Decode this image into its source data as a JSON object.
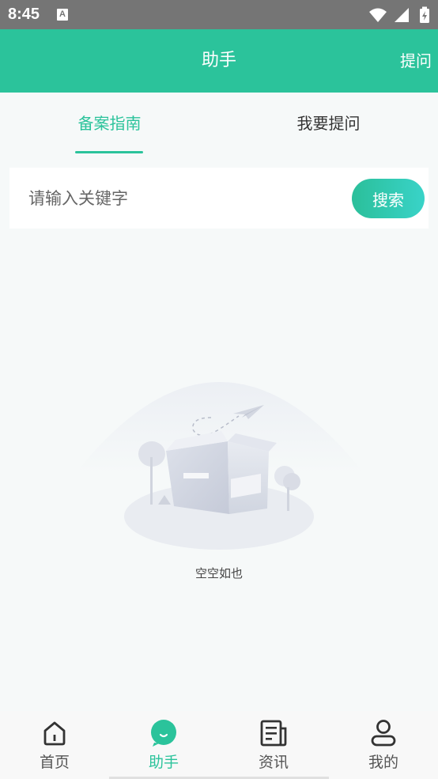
{
  "status_bar": {
    "time": "8:45",
    "notification_icon": "A",
    "icons": [
      "wifi-icon",
      "cell-signal-icon",
      "battery-charging-icon"
    ]
  },
  "header": {
    "title": "助手",
    "action": "提问",
    "background": "#2bc39b"
  },
  "tabs": [
    {
      "label": "备案指南",
      "active": true
    },
    {
      "label": "我要提问",
      "active": false
    }
  ],
  "search": {
    "placeholder": "请输入关键字",
    "value": "",
    "button_label": "搜索"
  },
  "empty_state": {
    "text": "空空如也",
    "icon": "empty-box-illustration"
  },
  "bottom_nav": [
    {
      "label": "首页",
      "icon": "home-icon",
      "active": false
    },
    {
      "label": "助手",
      "icon": "assistant-icon",
      "active": true
    },
    {
      "label": "资讯",
      "icon": "news-icon",
      "active": false
    },
    {
      "label": "我的",
      "icon": "user-icon",
      "active": false
    }
  ],
  "colors": {
    "accent": "#2bc39b",
    "search_gradient_start": "#2bbf9a",
    "search_gradient_end": "#39d3c8"
  }
}
